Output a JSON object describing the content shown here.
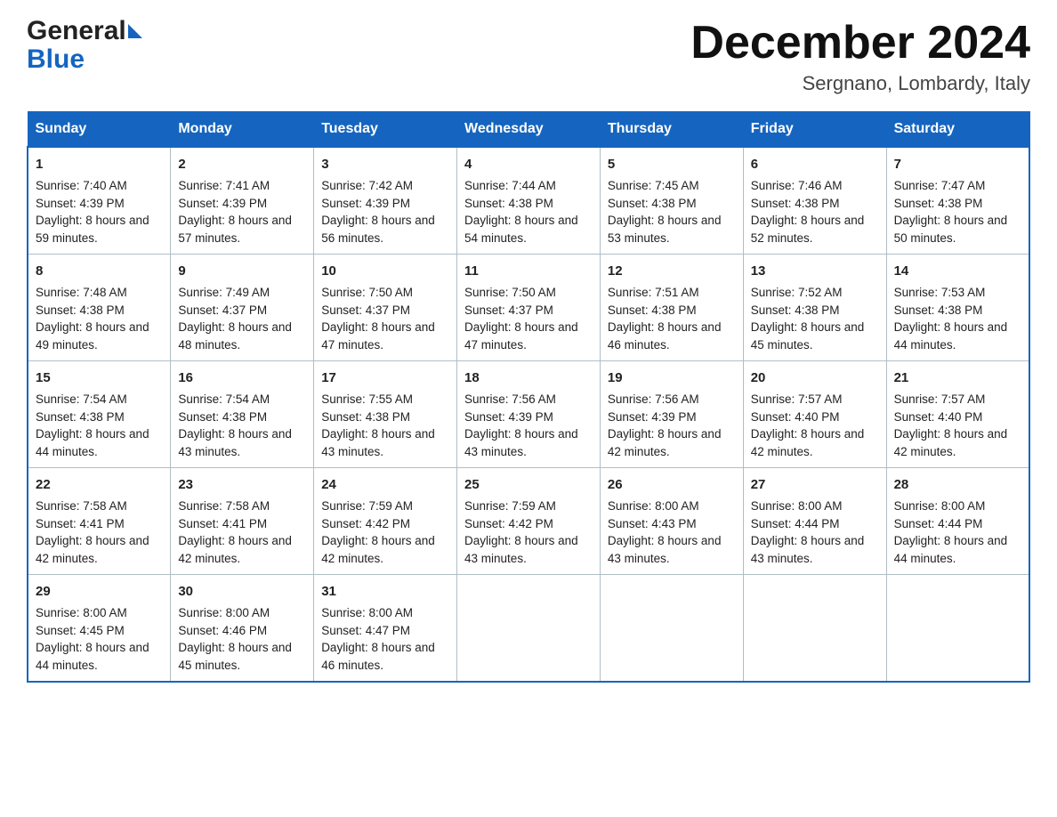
{
  "header": {
    "logo_general": "General",
    "logo_blue": "Blue",
    "month": "December 2024",
    "location": "Sergnano, Lombardy, Italy"
  },
  "days_header": [
    "Sunday",
    "Monday",
    "Tuesday",
    "Wednesday",
    "Thursday",
    "Friday",
    "Saturday"
  ],
  "weeks": [
    [
      {
        "day": "1",
        "sunrise": "Sunrise: 7:40 AM",
        "sunset": "Sunset: 4:39 PM",
        "daylight": "Daylight: 8 hours and 59 minutes."
      },
      {
        "day": "2",
        "sunrise": "Sunrise: 7:41 AM",
        "sunset": "Sunset: 4:39 PM",
        "daylight": "Daylight: 8 hours and 57 minutes."
      },
      {
        "day": "3",
        "sunrise": "Sunrise: 7:42 AM",
        "sunset": "Sunset: 4:39 PM",
        "daylight": "Daylight: 8 hours and 56 minutes."
      },
      {
        "day": "4",
        "sunrise": "Sunrise: 7:44 AM",
        "sunset": "Sunset: 4:38 PM",
        "daylight": "Daylight: 8 hours and 54 minutes."
      },
      {
        "day": "5",
        "sunrise": "Sunrise: 7:45 AM",
        "sunset": "Sunset: 4:38 PM",
        "daylight": "Daylight: 8 hours and 53 minutes."
      },
      {
        "day": "6",
        "sunrise": "Sunrise: 7:46 AM",
        "sunset": "Sunset: 4:38 PM",
        "daylight": "Daylight: 8 hours and 52 minutes."
      },
      {
        "day": "7",
        "sunrise": "Sunrise: 7:47 AM",
        "sunset": "Sunset: 4:38 PM",
        "daylight": "Daylight: 8 hours and 50 minutes."
      }
    ],
    [
      {
        "day": "8",
        "sunrise": "Sunrise: 7:48 AM",
        "sunset": "Sunset: 4:38 PM",
        "daylight": "Daylight: 8 hours and 49 minutes."
      },
      {
        "day": "9",
        "sunrise": "Sunrise: 7:49 AM",
        "sunset": "Sunset: 4:37 PM",
        "daylight": "Daylight: 8 hours and 48 minutes."
      },
      {
        "day": "10",
        "sunrise": "Sunrise: 7:50 AM",
        "sunset": "Sunset: 4:37 PM",
        "daylight": "Daylight: 8 hours and 47 minutes."
      },
      {
        "day": "11",
        "sunrise": "Sunrise: 7:50 AM",
        "sunset": "Sunset: 4:37 PM",
        "daylight": "Daylight: 8 hours and 47 minutes."
      },
      {
        "day": "12",
        "sunrise": "Sunrise: 7:51 AM",
        "sunset": "Sunset: 4:38 PM",
        "daylight": "Daylight: 8 hours and 46 minutes."
      },
      {
        "day": "13",
        "sunrise": "Sunrise: 7:52 AM",
        "sunset": "Sunset: 4:38 PM",
        "daylight": "Daylight: 8 hours and 45 minutes."
      },
      {
        "day": "14",
        "sunrise": "Sunrise: 7:53 AM",
        "sunset": "Sunset: 4:38 PM",
        "daylight": "Daylight: 8 hours and 44 minutes."
      }
    ],
    [
      {
        "day": "15",
        "sunrise": "Sunrise: 7:54 AM",
        "sunset": "Sunset: 4:38 PM",
        "daylight": "Daylight: 8 hours and 44 minutes."
      },
      {
        "day": "16",
        "sunrise": "Sunrise: 7:54 AM",
        "sunset": "Sunset: 4:38 PM",
        "daylight": "Daylight: 8 hours and 43 minutes."
      },
      {
        "day": "17",
        "sunrise": "Sunrise: 7:55 AM",
        "sunset": "Sunset: 4:38 PM",
        "daylight": "Daylight: 8 hours and 43 minutes."
      },
      {
        "day": "18",
        "sunrise": "Sunrise: 7:56 AM",
        "sunset": "Sunset: 4:39 PM",
        "daylight": "Daylight: 8 hours and 43 minutes."
      },
      {
        "day": "19",
        "sunrise": "Sunrise: 7:56 AM",
        "sunset": "Sunset: 4:39 PM",
        "daylight": "Daylight: 8 hours and 42 minutes."
      },
      {
        "day": "20",
        "sunrise": "Sunrise: 7:57 AM",
        "sunset": "Sunset: 4:40 PM",
        "daylight": "Daylight: 8 hours and 42 minutes."
      },
      {
        "day": "21",
        "sunrise": "Sunrise: 7:57 AM",
        "sunset": "Sunset: 4:40 PM",
        "daylight": "Daylight: 8 hours and 42 minutes."
      }
    ],
    [
      {
        "day": "22",
        "sunrise": "Sunrise: 7:58 AM",
        "sunset": "Sunset: 4:41 PM",
        "daylight": "Daylight: 8 hours and 42 minutes."
      },
      {
        "day": "23",
        "sunrise": "Sunrise: 7:58 AM",
        "sunset": "Sunset: 4:41 PM",
        "daylight": "Daylight: 8 hours and 42 minutes."
      },
      {
        "day": "24",
        "sunrise": "Sunrise: 7:59 AM",
        "sunset": "Sunset: 4:42 PM",
        "daylight": "Daylight: 8 hours and 42 minutes."
      },
      {
        "day": "25",
        "sunrise": "Sunrise: 7:59 AM",
        "sunset": "Sunset: 4:42 PM",
        "daylight": "Daylight: 8 hours and 43 minutes."
      },
      {
        "day": "26",
        "sunrise": "Sunrise: 8:00 AM",
        "sunset": "Sunset: 4:43 PM",
        "daylight": "Daylight: 8 hours and 43 minutes."
      },
      {
        "day": "27",
        "sunrise": "Sunrise: 8:00 AM",
        "sunset": "Sunset: 4:44 PM",
        "daylight": "Daylight: 8 hours and 43 minutes."
      },
      {
        "day": "28",
        "sunrise": "Sunrise: 8:00 AM",
        "sunset": "Sunset: 4:44 PM",
        "daylight": "Daylight: 8 hours and 44 minutes."
      }
    ],
    [
      {
        "day": "29",
        "sunrise": "Sunrise: 8:00 AM",
        "sunset": "Sunset: 4:45 PM",
        "daylight": "Daylight: 8 hours and 44 minutes."
      },
      {
        "day": "30",
        "sunrise": "Sunrise: 8:00 AM",
        "sunset": "Sunset: 4:46 PM",
        "daylight": "Daylight: 8 hours and 45 minutes."
      },
      {
        "day": "31",
        "sunrise": "Sunrise: 8:00 AM",
        "sunset": "Sunset: 4:47 PM",
        "daylight": "Daylight: 8 hours and 46 minutes."
      },
      null,
      null,
      null,
      null
    ]
  ]
}
